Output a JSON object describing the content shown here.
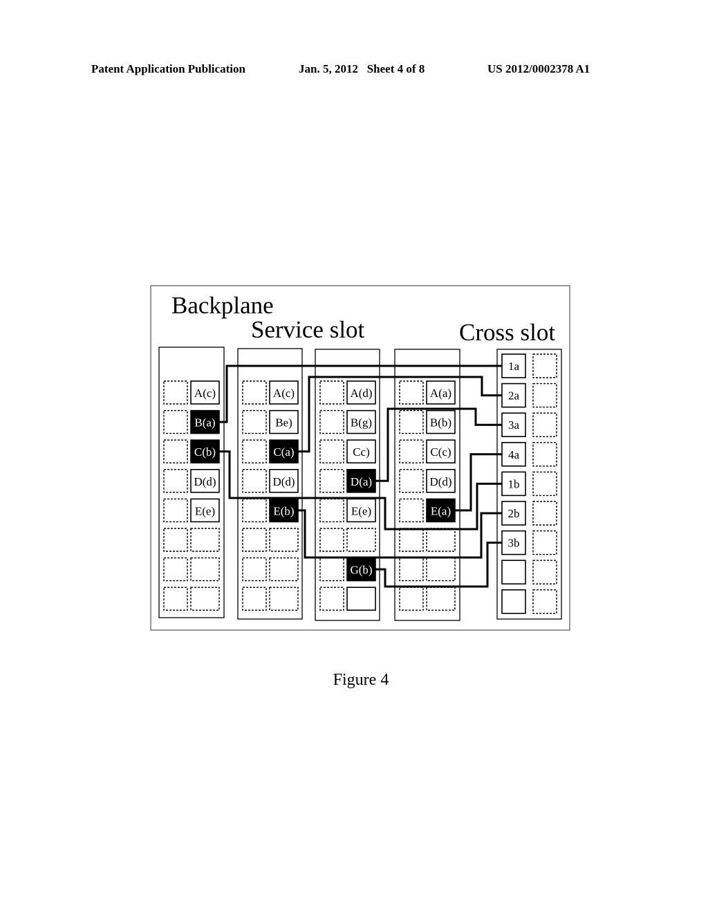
{
  "header": {
    "publication": "Patent Application Publication",
    "date_sheet": "Jan. 5, 2012   Sheet 4 of 8",
    "number": "US 2012/0002378 A1"
  },
  "figure": {
    "caption": "Figure 4",
    "title_backplane": "Backplane",
    "title_service_slot": "Service slot",
    "title_cross_slot": "Cross slot",
    "service_slots": [
      {
        "id": "slot-1",
        "rows": [
          {
            "label": "A(c)",
            "state": "normal"
          },
          {
            "label": "B(a)",
            "state": "active"
          },
          {
            "label": "C(b)",
            "state": "active"
          },
          {
            "label": "D(d)",
            "state": "normal"
          },
          {
            "label": "E(e)",
            "state": "normal"
          },
          {
            "label": "",
            "state": "empty"
          },
          {
            "label": "",
            "state": "empty"
          },
          {
            "label": "",
            "state": "empty"
          }
        ]
      },
      {
        "id": "slot-2",
        "rows": [
          {
            "label": "A(c)",
            "state": "normal"
          },
          {
            "label": "Be)",
            "state": "normal"
          },
          {
            "label": "C(a)",
            "state": "active"
          },
          {
            "label": "D(d)",
            "state": "normal"
          },
          {
            "label": "E(b)",
            "state": "active"
          },
          {
            "label": "",
            "state": "empty"
          },
          {
            "label": "",
            "state": "empty"
          },
          {
            "label": "",
            "state": "empty"
          }
        ]
      },
      {
        "id": "slot-3",
        "rows": [
          {
            "label": "A(d)",
            "state": "normal"
          },
          {
            "label": "B(g)",
            "state": "normal"
          },
          {
            "label": "Cc)",
            "state": "normal"
          },
          {
            "label": "D(a)",
            "state": "active"
          },
          {
            "label": "E(e)",
            "state": "normal"
          },
          {
            "label": "",
            "state": "empty"
          },
          {
            "label": "G(b)",
            "state": "active"
          },
          {
            "label": "",
            "state": "blank-solid"
          }
        ]
      },
      {
        "id": "slot-4",
        "rows": [
          {
            "label": "A(a)",
            "state": "normal"
          },
          {
            "label": "B(b)",
            "state": "normal"
          },
          {
            "label": "C(c)",
            "state": "normal"
          },
          {
            "label": "D(d)",
            "state": "normal"
          },
          {
            "label": "E(a)",
            "state": "active"
          },
          {
            "label": "",
            "state": "empty"
          },
          {
            "label": "",
            "state": "empty"
          },
          {
            "label": "",
            "state": "empty"
          }
        ]
      }
    ],
    "cross_slot": {
      "rows": [
        "1a",
        "2a",
        "3a",
        "4a",
        "1b",
        "2b",
        "3b",
        "",
        ""
      ]
    },
    "connections": [
      {
        "from": "B(a)",
        "to": "1a"
      },
      {
        "from": "C(a)",
        "to": "2a"
      },
      {
        "from": "D(a)",
        "to": "3a"
      },
      {
        "from": "E(a)",
        "to": "4a"
      },
      {
        "from": "C(b)",
        "to": "1b"
      },
      {
        "from": "E(b)",
        "to": "2b"
      },
      {
        "from": "G(b)",
        "to": "3b"
      }
    ]
  }
}
